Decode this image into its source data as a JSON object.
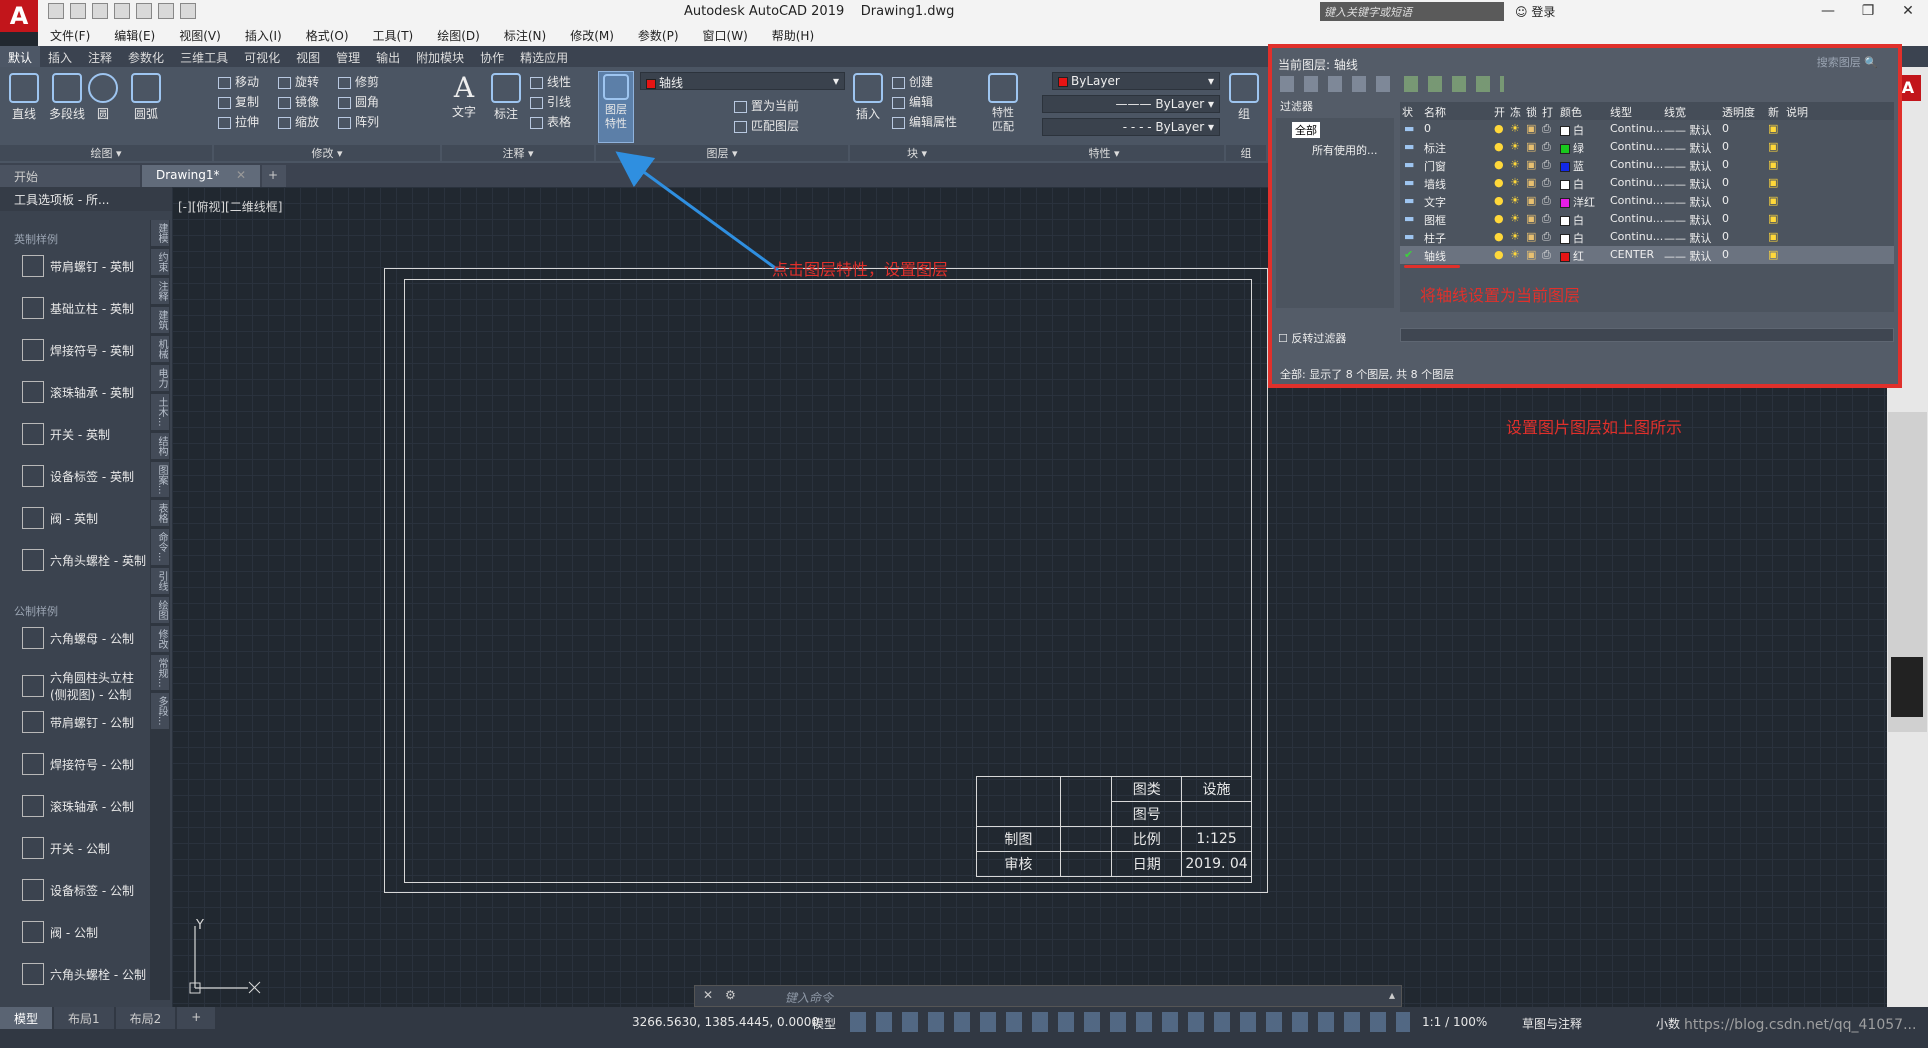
{
  "app": {
    "title": "Autodesk AutoCAD 2019    Drawing1.dwg",
    "logo": "A",
    "search_placeholder": "键入关键字或短语",
    "login": "登录"
  },
  "menu": [
    "文件(F)",
    "编辑(E)",
    "视图(V)",
    "插入(I)",
    "格式(O)",
    "工具(T)",
    "绘图(D)",
    "标注(N)",
    "修改(M)",
    "参数(P)",
    "窗口(W)",
    "帮助(H)"
  ],
  "ribbon_tabs": [
    "默认",
    "插入",
    "注释",
    "参数化",
    "三维工具",
    "可视化",
    "视图",
    "管理",
    "输出",
    "附加模块",
    "协作",
    "精选应用"
  ],
  "ribbon": {
    "draw": {
      "title": "绘图",
      "tools": [
        "直线",
        "多段线",
        "圆",
        "圆弧"
      ]
    },
    "modify": {
      "title": "修改",
      "tools": [
        "移动",
        "旋转",
        "修剪",
        "复制",
        "镜像",
        "圆角",
        "拉伸",
        "缩放",
        "阵列"
      ]
    },
    "annotation": {
      "title": "注释",
      "tools": [
        "文字",
        "标注",
        "线性",
        "引线",
        "表格"
      ]
    },
    "layers": {
      "title": "图层",
      "button": "图层\n特性",
      "current_layer": "轴线",
      "tools": [
        "置为当前",
        "匹配图层"
      ]
    },
    "block": {
      "title": "块",
      "tools": [
        "插入",
        "创建",
        "编辑",
        "编辑属性"
      ]
    },
    "properties": {
      "title": "特性",
      "match": "特性\n匹配",
      "color": "ByLayer",
      "lineweight": "ByLayer",
      "linetype": "ByLayer"
    },
    "group": {
      "title": "组",
      "button": "组"
    }
  },
  "doc_tabs": [
    "开始",
    "Drawing1*"
  ],
  "palette": {
    "title": "工具选项板 - 所...",
    "section1": "英制样例",
    "items1": [
      "带肩螺钉 - 英制",
      "基础立柱 - 英制",
      "焊接符号 - 英制",
      "滚珠轴承 - 英制",
      "开关 - 英制",
      "设备标签 - 英制",
      "阀 - 英制",
      "六角头螺栓 - 英制"
    ],
    "section2": "公制样例",
    "items2": [
      "六角螺母 - 公制",
      "六角圆柱头立柱 (侧视图) - 公制",
      "带肩螺钉 - 公制",
      "焊接符号 - 公制",
      "滚珠轴承 - 公制",
      "开关 - 公制",
      "设备标签 - 公制",
      "阀 - 公制",
      "六角头螺栓 - 公制"
    ],
    "vtabs": [
      "建模",
      "约束",
      "注释",
      "建筑",
      "机械",
      "电力",
      "土木...",
      "结构",
      "图案...",
      "表格",
      "命令...",
      "引线",
      "绘图",
      "修改",
      "常规...",
      "多段..."
    ]
  },
  "viewport_label": "[-][俯视][二维线框]",
  "title_block": {
    "cat_label": "图类",
    "cat_value": "设施",
    "num_label": "图号",
    "num_value": "",
    "draw_label": "制图",
    "scale_label": "比例",
    "scale_value": "1:125",
    "check_label": "审核",
    "date_label": "日期",
    "date_value": "2019. 04"
  },
  "ucs": {
    "y": "Y"
  },
  "command": {
    "placeholder": "键入命令"
  },
  "layout_tabs": [
    "模型",
    "布局1",
    "布局2"
  ],
  "status": {
    "coords": "3266.5630, 1385.4445, 0.0000",
    "model": "模型",
    "scale": "1:1 / 100%",
    "workspace": "草图与注释",
    "units": "小数",
    "watermark": "https://blog.csdn.net/qq_41057..."
  },
  "layer_manager": {
    "current": "当前图层: 轴线",
    "search": "搜索图层",
    "filter_header": "过滤器",
    "tree_all": "全部",
    "tree_used": "所有使用的...",
    "invert": "反转过滤器",
    "headers": [
      "状",
      "名称",
      "开",
      "冻",
      "锁",
      "打",
      "颜色",
      "线型",
      "线宽",
      "透明度",
      "新",
      "说明"
    ],
    "rows": [
      {
        "name": "0",
        "color_name": "白",
        "color": "#ffffff",
        "linetype": "Continu...",
        "lineweight": "默认",
        "transparency": "0"
      },
      {
        "name": "标注",
        "color_name": "绿",
        "color": "#19c81e",
        "linetype": "Continu...",
        "lineweight": "默认",
        "transparency": "0"
      },
      {
        "name": "门窗",
        "color_name": "蓝",
        "color": "#1228e6",
        "linetype": "Continu...",
        "lineweight": "默认",
        "transparency": "0"
      },
      {
        "name": "墙线",
        "color_name": "白",
        "color": "#ffffff",
        "linetype": "Continu...",
        "lineweight": "默认",
        "transparency": "0"
      },
      {
        "name": "文字",
        "color_name": "洋红",
        "color": "#e61ee6",
        "linetype": "Continu...",
        "lineweight": "默认",
        "transparency": "0"
      },
      {
        "name": "图框",
        "color_name": "白",
        "color": "#ffffff",
        "linetype": "Continu...",
        "lineweight": "默认",
        "transparency": "0"
      },
      {
        "name": "柱子",
        "color_name": "白",
        "color": "#ffffff",
        "linetype": "Continu...",
        "lineweight": "默认",
        "transparency": "0"
      },
      {
        "name": "轴线",
        "color_name": "红",
        "color": "#e61414",
        "linetype": "CENTER",
        "lineweight": "默认",
        "transparency": "0",
        "current": true
      }
    ],
    "footer": "全部: 显示了 8 个图层, 共 8 个图层"
  },
  "annotations": {
    "click_layer": "点击图层特性，设置图层",
    "set_current": "将轴线设置为当前图层",
    "set_as_above": "设置图片图层如上图所示"
  },
  "colors": {
    "accent_red": "#e0302b",
    "arrow_blue": "#2f8fe0"
  }
}
